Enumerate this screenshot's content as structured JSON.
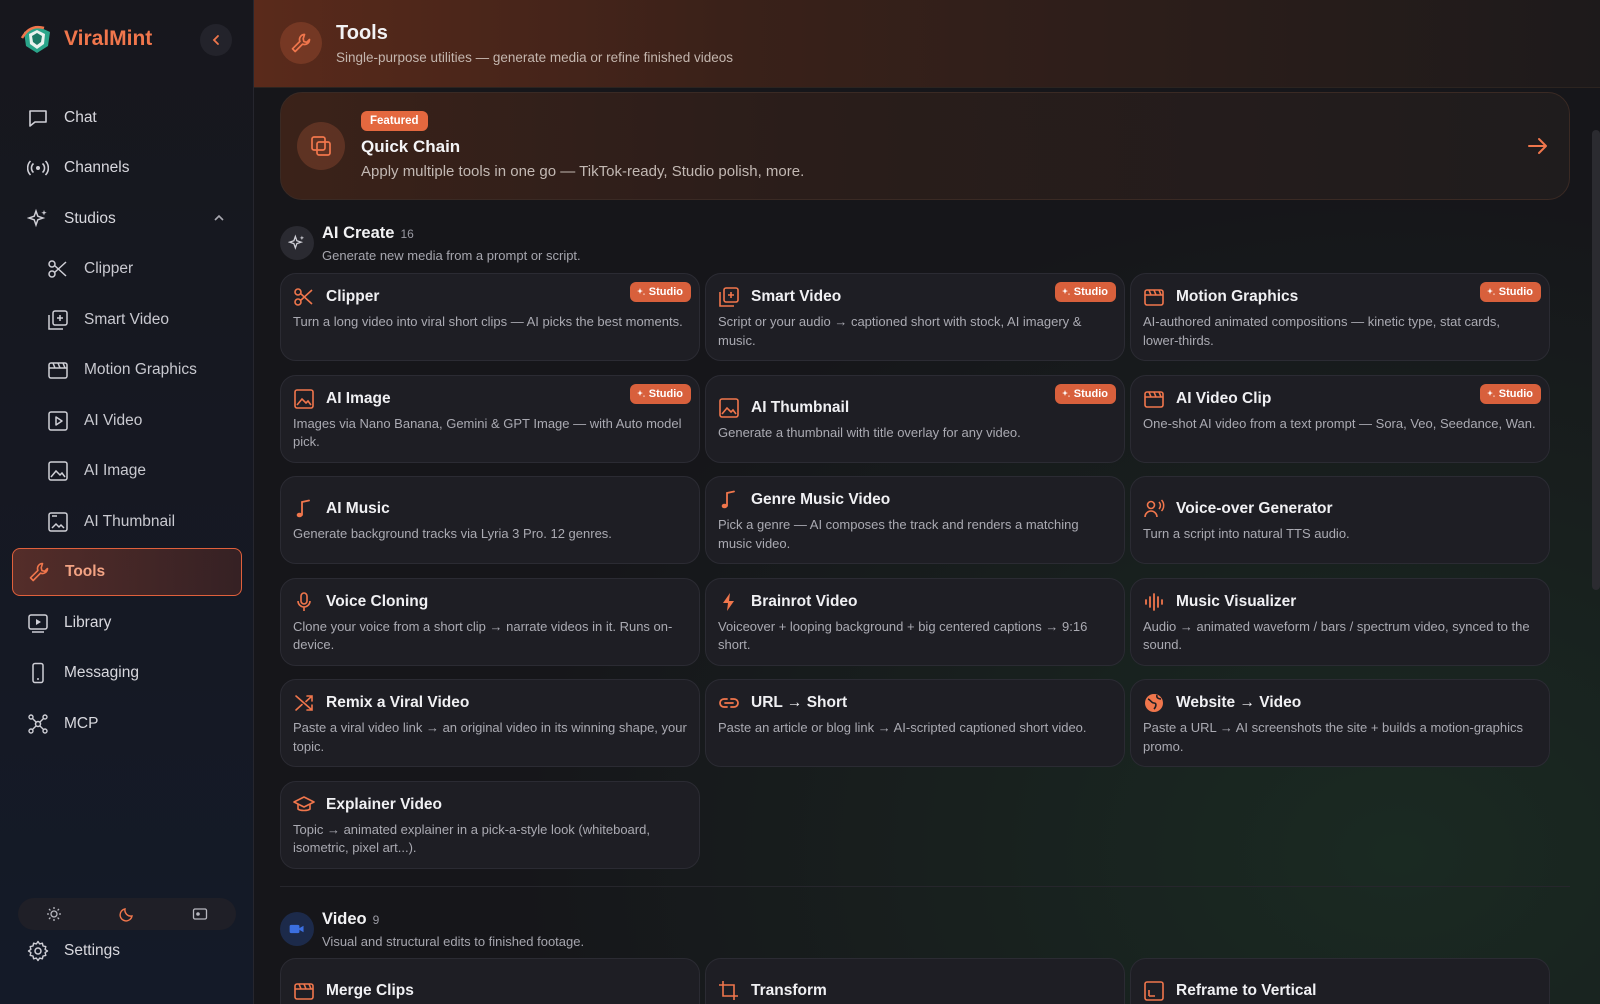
{
  "app": {
    "name": "ViralMint"
  },
  "sidebar": {
    "items": [
      {
        "label": "Chat",
        "icon": "chat-icon"
      },
      {
        "label": "Channels",
        "icon": "broadcast-icon"
      },
      {
        "label": "Studios",
        "icon": "sparkles-icon"
      },
      {
        "label": "Clipper",
        "icon": "scissors-icon"
      },
      {
        "label": "Smart Video",
        "icon": "plus-square-icon"
      },
      {
        "label": "Motion Graphics",
        "icon": "clapper-icon"
      },
      {
        "label": "AI Video",
        "icon": "play-square-icon"
      },
      {
        "label": "AI Image",
        "icon": "image-icon"
      },
      {
        "label": "AI Thumbnail",
        "icon": "thumbnail-icon"
      },
      {
        "label": "Tools",
        "icon": "wrench-icon",
        "active": true
      },
      {
        "label": "Library",
        "icon": "library-icon"
      },
      {
        "label": "Messaging",
        "icon": "phone-icon"
      },
      {
        "label": "MCP",
        "icon": "network-icon"
      }
    ],
    "settings_label": "Settings"
  },
  "header": {
    "title": "Tools",
    "subtitle": "Single-purpose utilities — generate media or refine finished videos"
  },
  "featured": {
    "badge": "Featured",
    "title": "Quick Chain",
    "description": "Apply multiple tools in one go — TikTok-ready, Studio polish, more."
  },
  "sections": [
    {
      "title": "AI Create",
      "count": "16",
      "subtitle": "Generate new media from a prompt or script.",
      "cards": [
        {
          "title": "Clipper",
          "desc": "Turn a long video into viral short clips — AI picks the best moments.",
          "badge": "Studio",
          "icon": "scissors-icon"
        },
        {
          "title": "Smart Video",
          "desc": "Script or your audio → captioned short with stock, AI imagery & music.",
          "badge": "Studio",
          "icon": "plus-square-icon"
        },
        {
          "title": "Motion Graphics",
          "desc": "AI-authored animated compositions — kinetic type, stat cards, lower-thirds.",
          "badge": "Studio",
          "icon": "clapper-icon"
        },
        {
          "title": "AI Image",
          "desc": "Images via Nano Banana, Gemini & GPT Image — with Auto model pick.",
          "badge": "Studio",
          "icon": "image-icon"
        },
        {
          "title": "AI Thumbnail",
          "desc": "Generate a thumbnail with title overlay for any video.",
          "badge": "Studio",
          "icon": "image-icon"
        },
        {
          "title": "AI Video Clip",
          "desc": "One-shot AI video from a text prompt — Sora, Veo, Seedance, Wan.",
          "badge": "Studio",
          "icon": "clapper-icon"
        },
        {
          "title": "AI Music",
          "desc": "Generate background tracks via Lyria 3 Pro. 12 genres.",
          "badge": "",
          "icon": "music-icon"
        },
        {
          "title": "Genre Music Video",
          "desc": "Pick a genre — AI composes the track and renders a matching music video.",
          "badge": "",
          "icon": "music-icon"
        },
        {
          "title": "Voice-over Generator",
          "desc": "Turn a script into natural TTS audio.",
          "badge": "",
          "icon": "speaker-person-icon"
        },
        {
          "title": "Voice Cloning",
          "desc": "Clone your voice from a short clip → narrate videos in it. Runs on-device.",
          "badge": "",
          "icon": "microphone-icon"
        },
        {
          "title": "Brainrot Video",
          "desc": "Voiceover + looping background + big centered captions → 9:16 short.",
          "badge": "",
          "icon": "bolt-icon"
        },
        {
          "title": "Music Visualizer",
          "desc": "Audio → animated waveform / bars / spectrum video, synced to the sound.",
          "badge": "",
          "icon": "waveform-icon"
        },
        {
          "title": "Remix a Viral Video",
          "desc": "Paste a viral video link → an original video in its winning shape, your topic.",
          "badge": "",
          "icon": "shuffle-icon"
        },
        {
          "title": "URL → Short",
          "desc": "Paste an article or blog link → AI-scripted captioned short video.",
          "badge": "",
          "icon": "link-icon"
        },
        {
          "title": "Website → Video",
          "desc": "Paste a URL → AI screenshots the site + builds a motion-graphics promo.",
          "badge": "",
          "icon": "globe-icon"
        },
        {
          "title": "Explainer Video",
          "desc": "Topic → animated explainer in a pick-a-style look (whiteboard, isometric, pixel art...).",
          "badge": "",
          "icon": "graduation-cap-icon"
        }
      ]
    },
    {
      "title": "Video",
      "count": "9",
      "subtitle": "Visual and structural edits to finished footage.",
      "cards": [
        {
          "title": "Merge Clips",
          "desc": "",
          "badge": "",
          "icon": "clapper-icon"
        },
        {
          "title": "Transform",
          "desc": "",
          "badge": "",
          "icon": "crop-icon"
        },
        {
          "title": "Reframe to Vertical",
          "desc": "",
          "badge": "",
          "icon": "reframe-icon"
        }
      ]
    }
  ],
  "colors": {
    "accent": "#f0764c",
    "badge": "#d8603c",
    "video_section": "#3b6fe0"
  }
}
